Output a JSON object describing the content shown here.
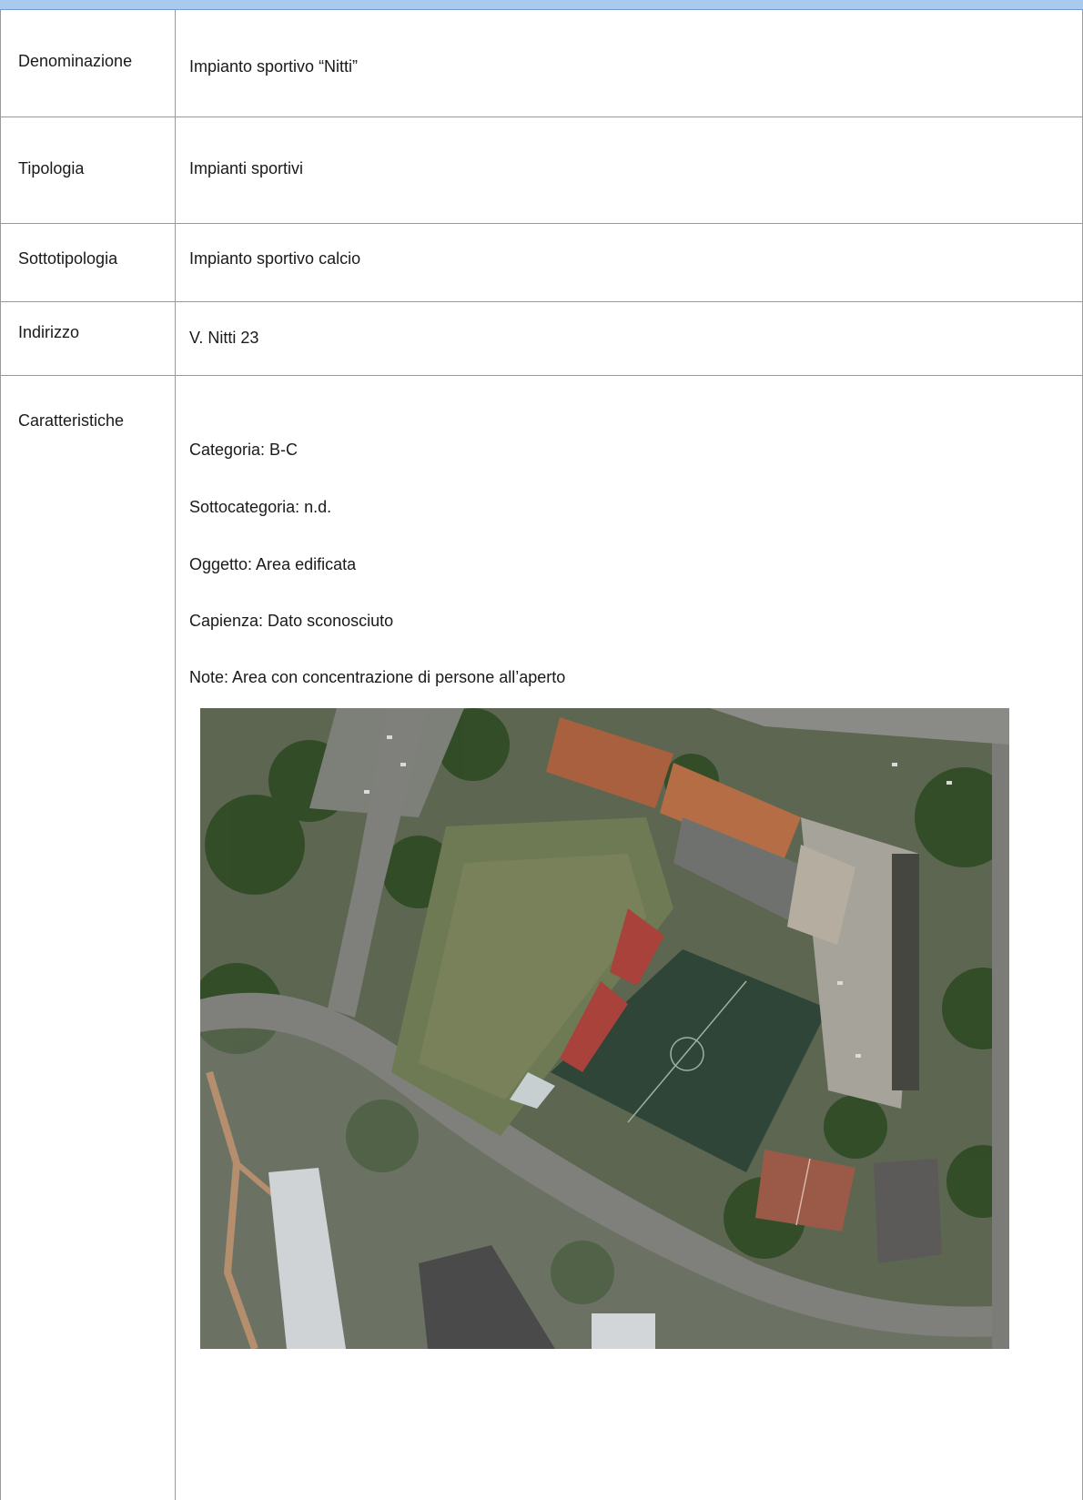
{
  "rows": [
    {
      "label": "Denominazione",
      "value": "Impianto sportivo “Nitti”"
    },
    {
      "label": "Tipologia",
      "value": "Impianti sportivi"
    },
    {
      "label": "Sottotipologia",
      "value": "Impianto sportivo calcio"
    },
    {
      "label": "Indirizzo",
      "value": "V. Nitti 23"
    }
  ],
  "caratteristiche": {
    "label": "Caratteristiche",
    "items": [
      "Categoria: B-C",
      "Sottocategoria: n.d.",
      "Oggetto: Area edificata",
      "Capienza: Dato sconosciuto",
      "Note: Area con concentrazione di persone all’aperto"
    ]
  },
  "colors": {
    "header_band": "#a9c9ef",
    "grid_lines": "#9a9a9a"
  }
}
